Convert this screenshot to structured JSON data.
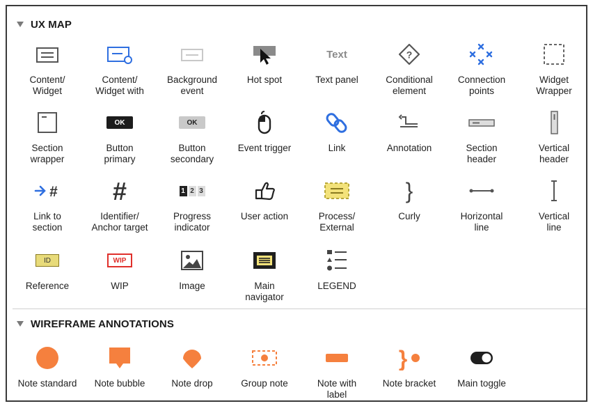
{
  "ux_map": {
    "title": "UX MAP",
    "items": [
      {
        "label": "Content/\nWidget",
        "icon": "content-widget-icon"
      },
      {
        "label": "Content/\nWidget with",
        "icon": "content-widget-with-icon"
      },
      {
        "label": "Background\nevent",
        "icon": "background-event-icon"
      },
      {
        "label": "Hot spot",
        "icon": "hot-spot-icon"
      },
      {
        "label": "Text panel",
        "icon": "text-panel-icon",
        "icon_text": "Text"
      },
      {
        "label": "Conditional\nelement",
        "icon": "conditional-element-icon"
      },
      {
        "label": "Connection\npoints",
        "icon": "connection-points-icon"
      },
      {
        "label": "Widget\nWrapper",
        "icon": "widget-wrapper-icon"
      },
      {
        "label": "Section\nwrapper",
        "icon": "section-wrapper-icon"
      },
      {
        "label": "Button\nprimary",
        "icon": "button-primary-icon",
        "icon_text": "OK"
      },
      {
        "label": "Button\nsecondary",
        "icon": "button-secondary-icon",
        "icon_text": "OK"
      },
      {
        "label": "Event trigger",
        "icon": "event-trigger-icon"
      },
      {
        "label": "Link",
        "icon": "link-icon"
      },
      {
        "label": "Annotation",
        "icon": "annotation-icon"
      },
      {
        "label": "Section\nheader",
        "icon": "section-header-icon"
      },
      {
        "label": "Vertical\nheader",
        "icon": "vertical-header-icon"
      },
      {
        "label": "Link to\nsection",
        "icon": "link-to-section-icon"
      },
      {
        "label": "Identifier/\nAnchor target",
        "icon": "identifier-icon"
      },
      {
        "label": "Progress\nindicator",
        "icon": "progress-indicator-icon",
        "icon_text": [
          "1",
          "2",
          "3"
        ]
      },
      {
        "label": "User action",
        "icon": "user-action-icon"
      },
      {
        "label": "Process/\nExternal",
        "icon": "process-external-icon"
      },
      {
        "label": "Curly",
        "icon": "curly-icon"
      },
      {
        "label": "Horizontal\nline",
        "icon": "horizontal-line-icon"
      },
      {
        "label": "Vertical\nline",
        "icon": "vertical-line-icon"
      },
      {
        "label": "Reference",
        "icon": "reference-icon",
        "icon_text": "ID"
      },
      {
        "label": "WIP",
        "icon": "wip-icon",
        "icon_text": "WIP"
      },
      {
        "label": "Image",
        "icon": "image-icon"
      },
      {
        "label": "Main\nnavigator",
        "icon": "main-navigator-icon"
      },
      {
        "label": "LEGEND",
        "icon": "legend-icon"
      }
    ]
  },
  "wireframe_annotations": {
    "title": "WIREFRAME ANNOTATIONS",
    "items": [
      {
        "label": "Note standard",
        "icon": "note-standard-icon"
      },
      {
        "label": "Note bubble",
        "icon": "note-bubble-icon"
      },
      {
        "label": "Note drop",
        "icon": "note-drop-icon"
      },
      {
        "label": "Group note",
        "icon": "group-note-icon"
      },
      {
        "label": "Note with\nlabel",
        "icon": "note-with-label-icon"
      },
      {
        "label": "Note bracket",
        "icon": "note-bracket-icon"
      },
      {
        "label": "Main toggle",
        "icon": "main-toggle-icon"
      }
    ]
  },
  "colors": {
    "accent_blue": "#2f6fe0",
    "orange": "#f5803e",
    "yellow": "#f3e27a",
    "red": "#e0302b"
  }
}
